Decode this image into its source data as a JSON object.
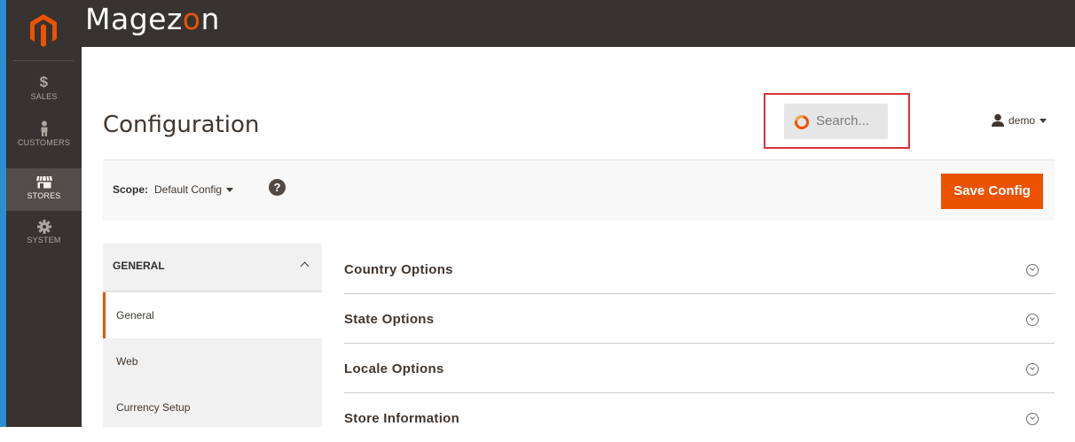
{
  "app": {
    "brand_prefix": "Magez",
    "brand_o": "o",
    "brand_suffix": "n",
    "accent": "#eb5202",
    "sidebar_bg": "#373330"
  },
  "nav": {
    "items": [
      {
        "label": "SALES",
        "icon": "dollar-icon"
      },
      {
        "label": "CUSTOMERS",
        "icon": "person-icon"
      },
      {
        "label": "STORES",
        "icon": "store-icon",
        "active": true
      },
      {
        "label": "SYSTEM",
        "icon": "gear-icon"
      }
    ]
  },
  "header": {
    "title": "Configuration",
    "search_placeholder": "Search...",
    "user": "demo"
  },
  "scope": {
    "label": "Scope:",
    "value": "Default Config",
    "help": "?",
    "save_label": "Save Config"
  },
  "tabs": {
    "group": "GENERAL",
    "items": [
      {
        "label": "General",
        "active": true
      },
      {
        "label": "Web"
      },
      {
        "label": "Currency Setup"
      }
    ]
  },
  "sections": [
    {
      "label": "Country Options"
    },
    {
      "label": "State Options"
    },
    {
      "label": "Locale Options"
    },
    {
      "label": "Store Information"
    }
  ]
}
